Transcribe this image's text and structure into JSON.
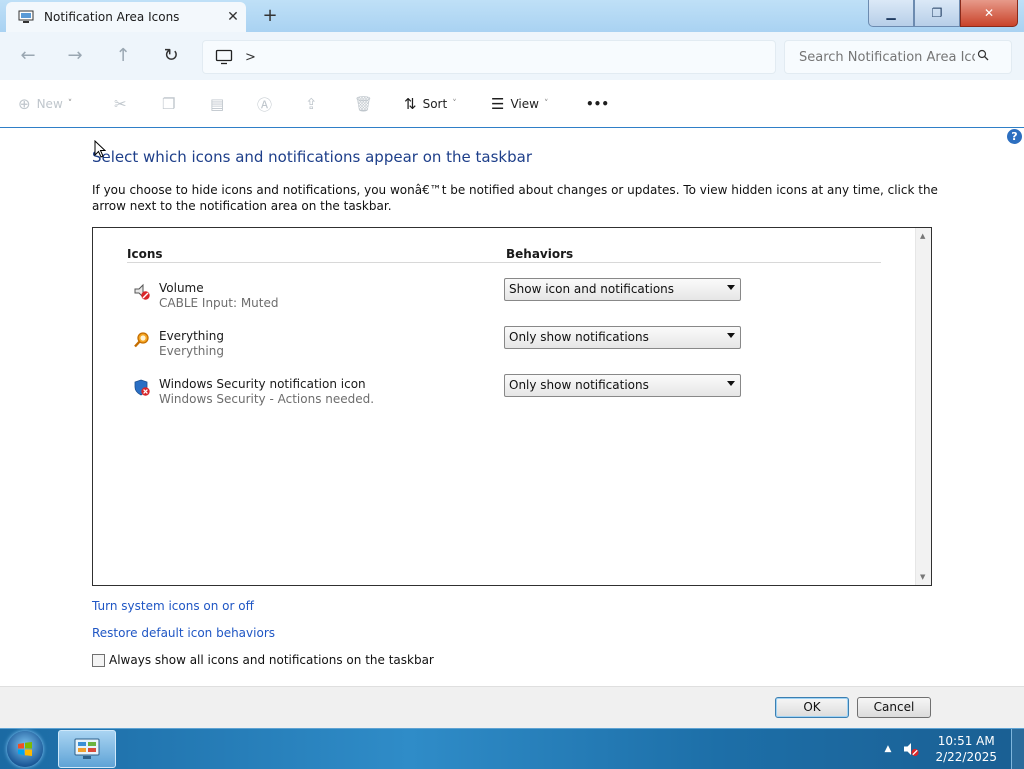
{
  "window": {
    "tab_title": "Notification Area Icons",
    "tab_close": "✕",
    "new_tab": "+",
    "buttons": {
      "minimize": "▁",
      "maximize": "❐",
      "close": "✕"
    }
  },
  "address_bar": {
    "back": "←",
    "forward": "→",
    "up": "↑",
    "refresh": "↻",
    "breadcrumb_chevron": ">",
    "search_placeholder": "Search Notification Area Icons"
  },
  "toolbar": {
    "new_label": "New",
    "sort_label": "Sort",
    "view_label": "View",
    "more_label": "•••"
  },
  "content": {
    "help": "?",
    "heading": "Select which icons and notifications appear on the taskbar",
    "description": "If you choose to hide icons and notifications, you wonâ€™t be notified about changes or updates. To view hidden icons at any time, click the arrow next to the notification area on the taskbar.",
    "columns": {
      "icons": "Icons",
      "behaviors": "Behaviors"
    },
    "rows": [
      {
        "name": "Volume",
        "detail": "CABLE Input: Muted",
        "behavior": "Show icon and notifications",
        "icon": "volume-muted-icon"
      },
      {
        "name": "Everything",
        "detail": "Everything",
        "behavior": "Only show notifications",
        "icon": "everything-search-icon"
      },
      {
        "name": "Windows Security notification icon",
        "detail": "Windows Security - Actions needed.",
        "behavior": "Only show notifications",
        "icon": "windows-security-shield-icon"
      }
    ],
    "links": {
      "system_icons": "Turn system icons on or off",
      "restore_defaults": "Restore default icon behaviors"
    },
    "always_show_label": "Always show all icons and notifications on the taskbar",
    "always_show_checked": false
  },
  "dialog_buttons": {
    "ok": "OK",
    "cancel": "Cancel"
  },
  "taskbar": {
    "time": "10:51 AM",
    "date": "2/22/2025",
    "tray_arrow": "▲"
  },
  "colors": {
    "heading": "#1e3f8a",
    "link": "#1f56c4",
    "taskbar": "#2f8cc8"
  }
}
